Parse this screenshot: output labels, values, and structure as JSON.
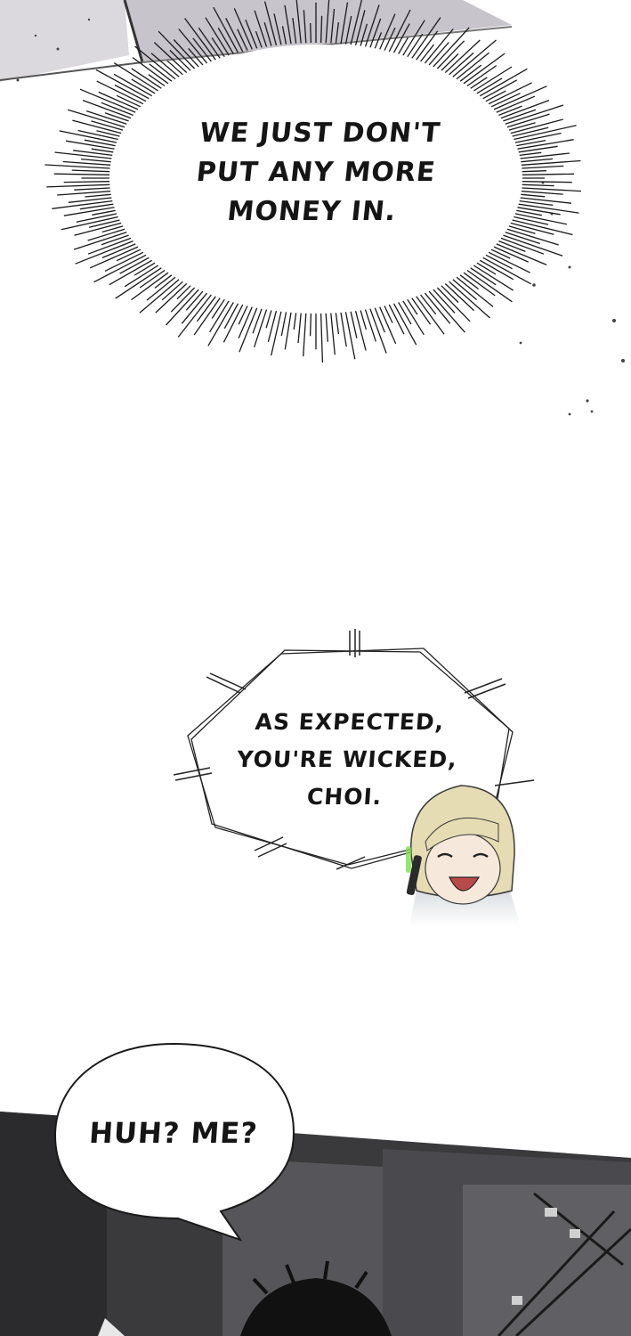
{
  "panels": {
    "burst_bubble": {
      "lines": [
        "WE JUST DON'T",
        "PUT ANY MORE",
        "MONEY IN."
      ]
    },
    "octagon_bubble": {
      "lines": [
        "AS EXPECTED,",
        "YOU'RE WICKED,",
        "CHOI."
      ]
    },
    "speech_bubble": {
      "lines": [
        "HUH? ME?"
      ]
    }
  },
  "colors": {
    "ink": "#151515",
    "top_panel": "#d9d6dc",
    "bottom_panel_dark": "#2b2b2e",
    "bottom_panel_mid": "#4a4a4e",
    "phone_glow": "#7be04a",
    "hair": "#e6dcb4"
  }
}
